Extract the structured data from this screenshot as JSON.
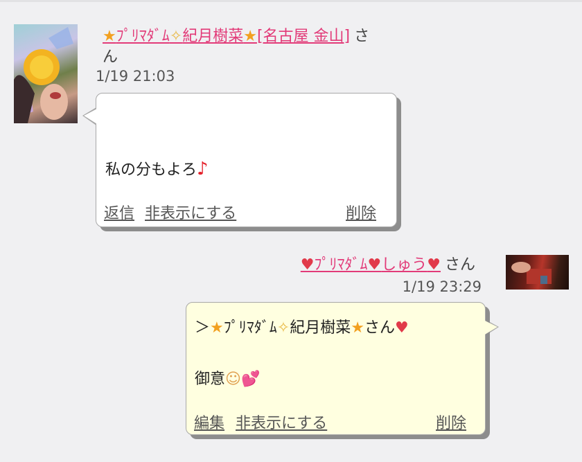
{
  "messages": [
    {
      "author": {
        "pre": "★",
        "p1": "ﾌﾟﾘﾏﾀﾞﾑ",
        "spark": "✧",
        "p2": "紀月樹菜",
        "post": "★",
        "p3": "[名古屋 金山]",
        "suffix": "さん"
      },
      "time": "1/19 21:03",
      "body": "私の分もよろ",
      "body_emoji": "♪",
      "actions": {
        "reply": "返信",
        "hide": "非表示にする",
        "delete": "削除"
      }
    },
    {
      "author": {
        "h1": "♥",
        "p1": "ﾌﾟﾘﾏﾀﾞﾑ",
        "h2": "♥",
        "p2": "しゅう",
        "h3": "♥",
        "suffix": "さん"
      },
      "time": "1/19 23:29",
      "quote": {
        "gt": "＞",
        "star1": "★",
        "p1": "ﾌﾟﾘﾏﾀﾞﾑ",
        "spark": "✧",
        "p2": "紀月樹菜",
        "star2": "★",
        "suffix": "さん",
        "heart": "♥"
      },
      "body": "御意",
      "body_emoji1": "☺",
      "body_emoji2": "💕",
      "actions": {
        "edit": "編集",
        "hide": "非表示にする",
        "delete": "削除"
      }
    }
  ]
}
